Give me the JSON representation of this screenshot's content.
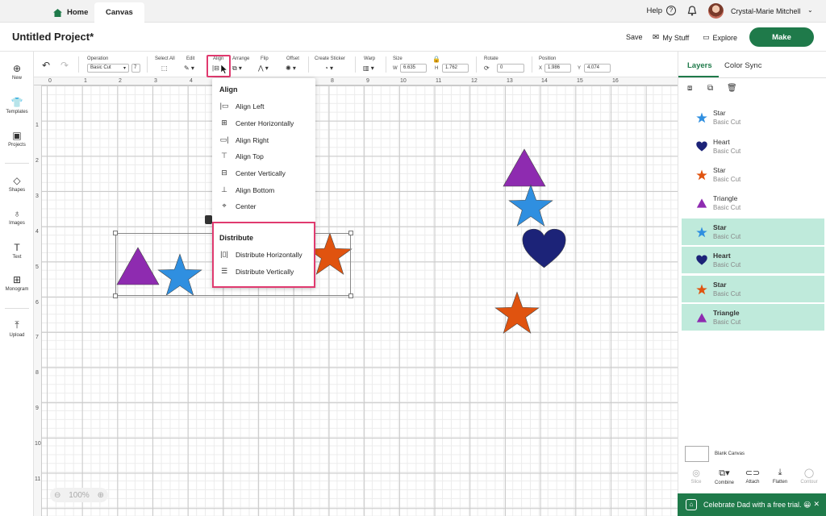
{
  "topbar": {
    "home": "Home",
    "canvas": "Canvas",
    "help": "Help",
    "user_name": "Crystal-Marie Mitchell"
  },
  "header": {
    "title": "Untitled Project*",
    "save": "Save",
    "my_stuff": "My Stuff",
    "explore": "Explore",
    "make": "Make"
  },
  "toolbar": {
    "operation_label": "Operation",
    "operation_value": "Basic Cut",
    "select_all": "Select All",
    "edit": "Edit",
    "align": "Align",
    "arrange": "Arrange",
    "flip": "Flip",
    "offset": "Offset",
    "create_sticker": "Create Sticker",
    "warp": "Warp",
    "size": "Size",
    "w_label": "W",
    "w_value": "6.635",
    "h_label": "H",
    "h_value": "1.762",
    "rotate": "Rotate",
    "rotate_value": "0",
    "position": "Position",
    "x_label": "X",
    "x_value": "1.986",
    "y_label": "Y",
    "y_value": "4.074"
  },
  "leftnav": [
    "New",
    "Templates",
    "Projects",
    "Shapes",
    "Images",
    "Text",
    "Monogram",
    "Upload"
  ],
  "ruler": {
    "top": [
      "0",
      "1",
      "2",
      "3",
      "4",
      "5",
      "6",
      "7",
      "8",
      "9",
      "10",
      "11",
      "12",
      "13",
      "14",
      "15",
      "16"
    ],
    "left": [
      "1",
      "2",
      "3",
      "4",
      "5",
      "6",
      "7",
      "8",
      "9",
      "10",
      "11"
    ]
  },
  "zoom": "100%",
  "align_menu": {
    "heading": "Align",
    "items": [
      "Align Left",
      "Center Horizontally",
      "Align Right",
      "Align Top",
      "Center Vertically",
      "Align Bottom",
      "Center"
    ],
    "distribute_heading": "Distribute",
    "distribute_items": [
      "Distribute Horizontally",
      "Distribute Vertically"
    ]
  },
  "right_panel": {
    "tab_layers": "Layers",
    "tab_color_sync": "Color Sync",
    "layers": [
      {
        "name": "Star",
        "type": "Basic Cut",
        "shape": "star",
        "color": "#2f8fe0",
        "selected": false
      },
      {
        "name": "Heart",
        "type": "Basic Cut",
        "shape": "heart",
        "color": "#1c2378",
        "selected": false
      },
      {
        "name": "Star",
        "type": "Basic Cut",
        "shape": "star",
        "color": "#e0530f",
        "selected": false
      },
      {
        "name": "Triangle",
        "type": "Basic Cut",
        "shape": "triangle",
        "color": "#8e2bb0",
        "selected": false
      },
      {
        "name": "Star",
        "type": "Basic Cut",
        "shape": "star",
        "color": "#2f8fe0",
        "selected": true
      },
      {
        "name": "Heart",
        "type": "Basic Cut",
        "shape": "heart",
        "color": "#1c2378",
        "selected": true
      },
      {
        "name": "Star",
        "type": "Basic Cut",
        "shape": "star",
        "color": "#e0530f",
        "selected": true
      },
      {
        "name": "Triangle",
        "type": "Basic Cut",
        "shape": "triangle",
        "color": "#8e2bb0",
        "selected": true
      }
    ],
    "blank_canvas": "Blank Canvas",
    "actions": [
      "Slice",
      "Combine",
      "Attach",
      "Flatten",
      "Contour"
    ]
  },
  "promo": "Celebrate Dad with a free trial. 😀",
  "colors": {
    "brand": "#1f7a4a",
    "highlight": "#e03a6f",
    "star_blue": "#2f8fe0",
    "star_orange": "#e0530f",
    "triangle": "#8e2bb0",
    "heart": "#1c2378",
    "layer_selected": "#bfeadb"
  }
}
